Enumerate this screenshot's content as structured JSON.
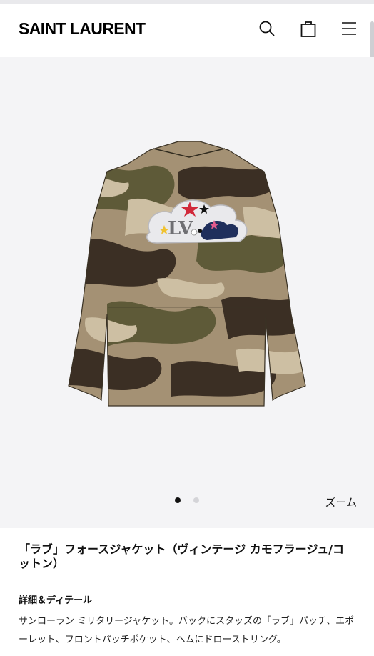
{
  "header": {
    "brand": "SAINT LAURENT",
    "icons": [
      "search-icon",
      "bag-icon",
      "menu-icon"
    ]
  },
  "gallery": {
    "image_alt": "camouflage field jacket",
    "dots": {
      "total": 2,
      "active": 1
    },
    "zoom_label": "ズーム"
  },
  "product": {
    "title": "「ラブ」フォースジャケット（ヴィンテージ カモフラージュ/コットン）",
    "details_heading": "詳細＆ディテール",
    "description": "サンローラン ミリタリージャケット。バックにスタッズの「ラブ」パッチ、エポーレット、フロントパッチポケット、ヘムにドローストリング。"
  },
  "colors": {
    "background": "#f4f4f6",
    "text": "#111111",
    "accent": "#000000"
  }
}
